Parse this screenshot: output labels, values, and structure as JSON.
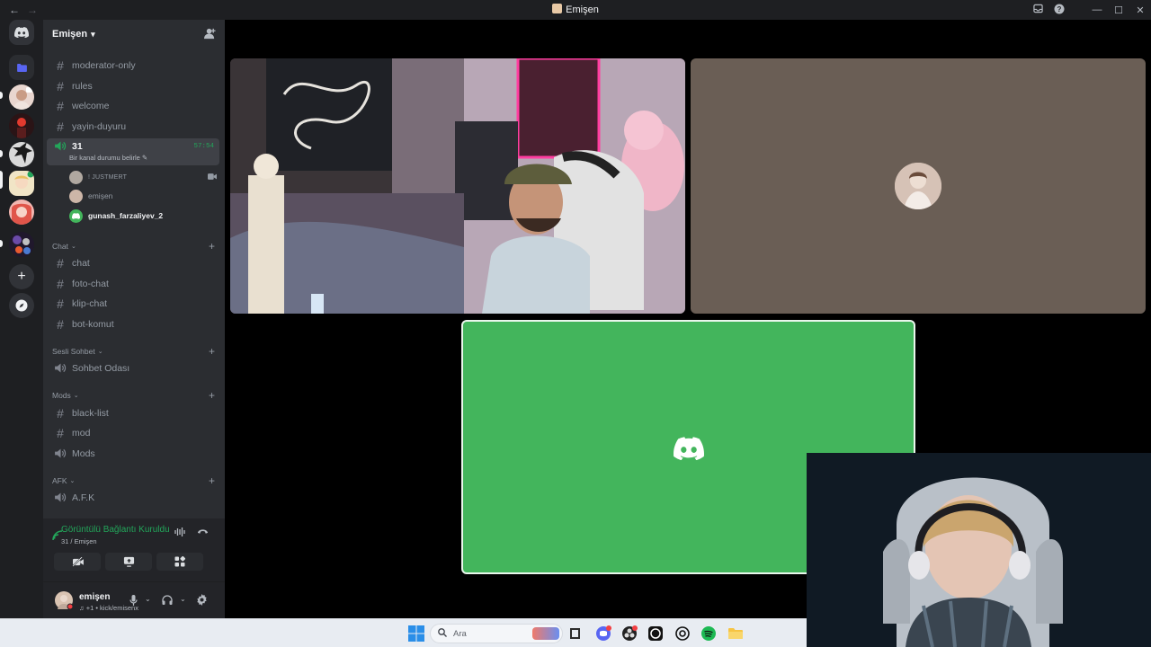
{
  "window": {
    "title": "Emişen",
    "nav_back": "←",
    "nav_forward": "→",
    "controls": {
      "minimize": "—",
      "maximize": "☐",
      "close": "✕"
    }
  },
  "server": {
    "name": "Emişen"
  },
  "channels_top": [
    {
      "name": "moderator-only",
      "type": "text"
    },
    {
      "name": "rules",
      "type": "text"
    },
    {
      "name": "welcome",
      "type": "text"
    },
    {
      "name": "yayin-duyuru",
      "type": "text"
    }
  ],
  "voice_active": {
    "name": "31",
    "status": "Bir kanal durumu belirle",
    "timer": "57:54",
    "users": [
      {
        "name": "! JUSTMERT",
        "icon": "video-icon"
      },
      {
        "name": "emişen"
      },
      {
        "name": "gunash_farzaliyev_2"
      }
    ]
  },
  "categories": [
    {
      "name": "Chat",
      "channels": [
        {
          "name": "chat",
          "type": "text"
        },
        {
          "name": "foto-chat",
          "type": "text"
        },
        {
          "name": "klip-chat",
          "type": "text"
        },
        {
          "name": "bot-komut",
          "type": "text"
        }
      ]
    },
    {
      "name": "Sesli Sohbet",
      "channels": [
        {
          "name": "Sohbet Odası",
          "type": "voice"
        }
      ]
    },
    {
      "name": "Mods",
      "channels": [
        {
          "name": "black-list",
          "type": "text"
        },
        {
          "name": "mod",
          "type": "text"
        },
        {
          "name": "Mods",
          "type": "voice"
        }
      ]
    },
    {
      "name": "AFK",
      "channels": [
        {
          "name": "A.F.K",
          "type": "voice"
        }
      ]
    }
  ],
  "voice_panel": {
    "status": "Görüntülü Bağlantı Kuruldu",
    "location": "31 / Emişen"
  },
  "user": {
    "name": "emişen",
    "subtext": "♫ +1 • kick/emisenx"
  },
  "taskbar": {
    "search_placeholder": "Ara"
  },
  "colors": {
    "accent_green": "#23a55a",
    "tile_green": "#43b55c",
    "blurple": "#5865f2"
  }
}
